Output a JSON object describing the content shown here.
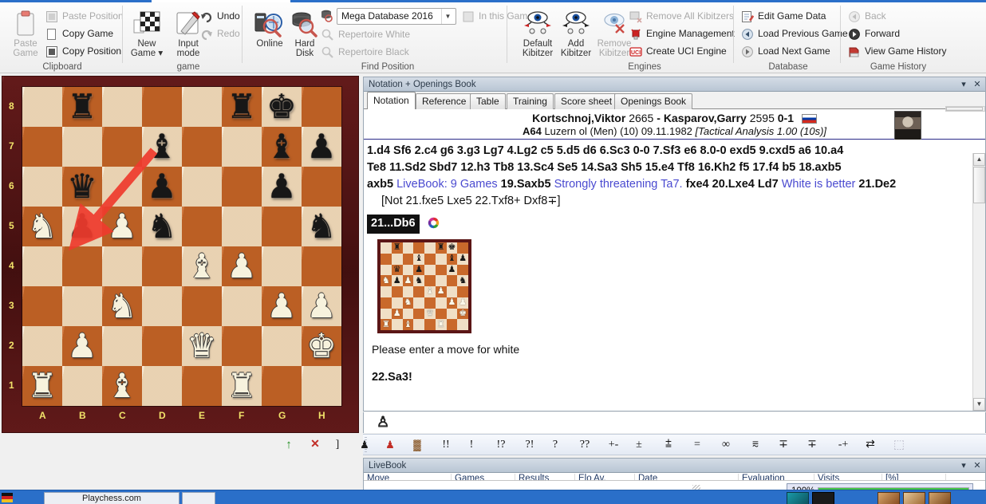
{
  "ribbon": {
    "groups": [
      {
        "label": "Clipboard",
        "big": [
          {
            "l1": "Paste",
            "l2": "Game",
            "icon": "clipboard-icon",
            "disabled": true
          }
        ],
        "small": [
          {
            "label": "Paste Position",
            "icon": "paste-position-icon",
            "disabled": true
          },
          {
            "label": "Copy Game",
            "icon": "copy-game-icon",
            "disabled": false
          },
          {
            "label": "Copy Position",
            "icon": "copy-position-icon",
            "disabled": false
          }
        ]
      },
      {
        "label": "game",
        "big": [
          {
            "l1": "New",
            "l2": "Game ▾",
            "icon": "new-game-icon",
            "disabled": false
          },
          {
            "l1": "Input",
            "l2": "mode",
            "icon": "input-mode-icon",
            "disabled": false
          }
        ],
        "small": [
          {
            "label": "Undo",
            "icon": "undo-icon",
            "disabled": false
          },
          {
            "label": "Redo",
            "icon": "redo-icon",
            "disabled": true
          }
        ]
      },
      {
        "label": "Find Position",
        "big": [
          {
            "l1": "Online",
            "l2": "",
            "icon": "online-search-icon",
            "disabled": false
          },
          {
            "l1": "Hard",
            "l2": "Disk",
            "icon": "hard-disk-search-icon",
            "disabled": false
          }
        ],
        "small": [
          {
            "label": "Repertoire White",
            "icon": "repertoire-white-icon",
            "disabled": true
          },
          {
            "label": "Repertoire Black",
            "icon": "repertoire-black-icon",
            "disabled": true
          }
        ],
        "combo": {
          "value": "Mega Database 2016"
        },
        "extra": {
          "label": "In this Game",
          "icon": "in-this-game-icon",
          "disabled": true
        }
      },
      {
        "label": "Engines",
        "big": [
          {
            "l1": "Default",
            "l2": "Kibitzer",
            "icon": "default-kibitzer-icon",
            "disabled": false
          },
          {
            "l1": "Add",
            "l2": "Kibitzer",
            "icon": "add-kibitzer-icon",
            "disabled": false
          },
          {
            "l1": "Remove",
            "l2": "Kibitzer",
            "icon": "remove-kibitzer-icon",
            "disabled": true
          }
        ],
        "small": [
          {
            "label": "Remove All Kibitzers",
            "icon": "remove-all-kibitzers-icon",
            "disabled": true
          },
          {
            "label": "Engine Management",
            "icon": "engine-management-icon",
            "disabled": false
          },
          {
            "label": "Create UCI Engine",
            "icon": "create-uci-engine-icon",
            "disabled": false
          }
        ]
      },
      {
        "label": "Database",
        "big": [],
        "small": [
          {
            "label": "Edit Game Data",
            "icon": "edit-game-data-icon",
            "disabled": false
          },
          {
            "label": "Load Previous Game",
            "icon": "load-previous-game-icon",
            "disabled": false
          },
          {
            "label": "Load Next Game",
            "icon": "load-next-game-icon",
            "disabled": false
          }
        ]
      },
      {
        "label": "Game History",
        "big": [],
        "small": [
          {
            "label": "Back",
            "icon": "back-icon",
            "disabled": true
          },
          {
            "label": "Forward",
            "icon": "forward-icon",
            "disabled": false
          },
          {
            "label": "View Game History",
            "icon": "view-game-history-icon",
            "disabled": false
          }
        ]
      }
    ]
  },
  "board": {
    "files": [
      "A",
      "B",
      "C",
      "D",
      "E",
      "F",
      "G",
      "H"
    ],
    "ranks": [
      "8",
      "7",
      "6",
      "5",
      "4",
      "3",
      "2",
      "1"
    ],
    "position": [
      [
        "",
        "r",
        "",
        "",
        "",
        "r",
        "k",
        ""
      ],
      [
        "",
        "",
        "",
        "b",
        "",
        "",
        "b",
        "p"
      ],
      [
        "",
        "q",
        "",
        "p",
        "",
        "",
        "p",
        ""
      ],
      [
        "N",
        "p",
        "P",
        "n",
        "",
        "",
        "",
        "n"
      ],
      [
        "",
        "",
        "",
        "",
        "B",
        "P",
        "",
        ""
      ],
      [
        "",
        "",
        "N",
        "",
        "",
        "",
        "P",
        "P"
      ],
      [
        "",
        "P",
        "",
        "",
        "Q",
        "",
        "",
        "K"
      ],
      [
        "R",
        "",
        "B",
        "",
        "",
        "R",
        "",
        ""
      ]
    ],
    "arrow": {
      "from": "d7",
      "to": "a5",
      "color": "#ef3b2d"
    }
  },
  "notationPanel": {
    "title": "Notation + Openings Book",
    "collapse_glyph": "▾",
    "close_glyph": "✕",
    "tabs": [
      {
        "label": "Notation",
        "active": true
      },
      {
        "label": "Reference",
        "active": false
      },
      {
        "label": "Table",
        "active": false
      },
      {
        "label": "Training",
        "active": false
      },
      {
        "label": "Score sheet",
        "active": false
      },
      {
        "label": "Openings Book",
        "active": false
      }
    ],
    "game": {
      "white_name": "Kortschnoj,Viktor",
      "white_elo": "2665",
      "dash": "-",
      "black_name": "Kasparov,Garry",
      "black_elo": "2595",
      "result": "0-1",
      "eco": "A64",
      "event": "Luzern ol (Men) (10) 09.11.1982",
      "analysis_note": "[Tactical Analysis 1.00 (10s)]"
    },
    "moves_line1": "1.d4  Sf6  2.c4  g6  3.g3  Lg7  4.Lg2  c5  5.d5  d6  6.Sc3  0-0  7.Sf3  e6  8.0-0  exd5  9.cxd5  a6  10.a4",
    "moves_line2": "Te8  11.Sd2  Sbd7  12.h3  Tb8  13.Sc4  Se5  14.Sa3  Sh5  15.e4  Tf8  16.Kh2  f5  17.f4  b5  18.axb5",
    "moves_line3_parts": [
      {
        "text": "axb5",
        "kind": "move"
      },
      {
        "text": "LiveBook: 9 Games",
        "kind": "comment"
      },
      {
        "text": "19.Saxb5",
        "kind": "move"
      },
      {
        "text": "Strongly threatening Ta7.",
        "kind": "comment"
      },
      {
        "text": "fxe4",
        "kind": "move"
      },
      {
        "text": "20.Lxe4",
        "kind": "move"
      },
      {
        "text": "Ld7",
        "kind": "move"
      },
      {
        "text": "White is better",
        "kind": "comment"
      },
      {
        "text": "21.De2",
        "kind": "move"
      }
    ],
    "variation": "[Not 21.fxe5  Lxe5  22.Txf8+  Dxf8∓]",
    "selected_move": "21...Db6",
    "hint": "Please enter a move for white",
    "next_move": "22.Sa3!",
    "mini_position": [
      [
        "",
        "r",
        "",
        "",
        "",
        "r",
        "k",
        ""
      ],
      [
        "",
        "",
        "",
        "b",
        "",
        "",
        "b",
        "p"
      ],
      [
        "",
        "q",
        "",
        "p",
        "",
        "",
        "p",
        ""
      ],
      [
        "N",
        "p",
        "P",
        "n",
        "",
        "",
        "",
        "n"
      ],
      [
        "",
        "",
        "",
        "",
        "B",
        "P",
        "",
        ""
      ],
      [
        "",
        "",
        "N",
        "",
        "",
        "",
        "P",
        "P"
      ],
      [
        "",
        "P",
        "",
        "",
        "Q",
        "",
        "",
        "K"
      ],
      [
        "R",
        "",
        "B",
        "",
        "",
        "R",
        "",
        ""
      ]
    ]
  },
  "annotationBar": {
    "items": [
      {
        "glyph": "↑",
        "name": "initiative"
      },
      {
        "glyph": "✕",
        "name": "counterplay"
      },
      {
        "glyph": "]",
        "name": "with-file"
      },
      {
        "glyph": "♟",
        "name": "black-pawn-symbol"
      },
      {
        "glyph": "♟",
        "name": "red-pawn-symbol"
      },
      {
        "glyph": "▓",
        "name": "pawn-structure-symbol"
      },
      {
        "glyph": "!!",
        "name": "brilliant"
      },
      {
        "glyph": "!",
        "name": "good-move"
      },
      {
        "glyph": "!?",
        "name": "interesting-move"
      },
      {
        "glyph": "?!",
        "name": "dubious-move"
      },
      {
        "glyph": "?",
        "name": "mistake"
      },
      {
        "glyph": "??",
        "name": "blunder"
      },
      {
        "glyph": "+-",
        "name": "white-winning"
      },
      {
        "glyph": "±",
        "name": "white-clearly-better"
      },
      {
        "glyph": "⩲",
        "name": "white-slightly-better"
      },
      {
        "glyph": "=",
        "name": "equal"
      },
      {
        "glyph": "∞",
        "name": "unclear"
      },
      {
        "glyph": "⩳",
        "name": "compensation"
      },
      {
        "glyph": "∓",
        "name": "black-clearly-better"
      },
      {
        "glyph": "∓",
        "name": "black-slightly-better"
      },
      {
        "glyph": "-+",
        "name": "black-winning"
      },
      {
        "glyph": "⇄",
        "name": "with-attack"
      },
      {
        "glyph": "⬚",
        "name": "eraser"
      }
    ]
  },
  "liveBook": {
    "title": "LiveBook",
    "collapse_glyph": "▾",
    "close_glyph": "✕",
    "columns": [
      "Move",
      "Games",
      "Results",
      "Elo Av.",
      "Date",
      "Evaluation",
      "Visits",
      "[%]"
    ]
  },
  "progress": {
    "label": "100%",
    "percent": 100
  },
  "statusbar": {
    "tile_label": "Playchess.com"
  },
  "colors": {
    "ribbon_accent": "#2a6fc9",
    "board_frame": "#5b1616",
    "light_square": "#f2dfc2",
    "dark_square": "#cc6a2a",
    "arrow": "#ef3b2d",
    "comment_blue": "#4a4ad0",
    "progress_green": "#0aa50a"
  }
}
